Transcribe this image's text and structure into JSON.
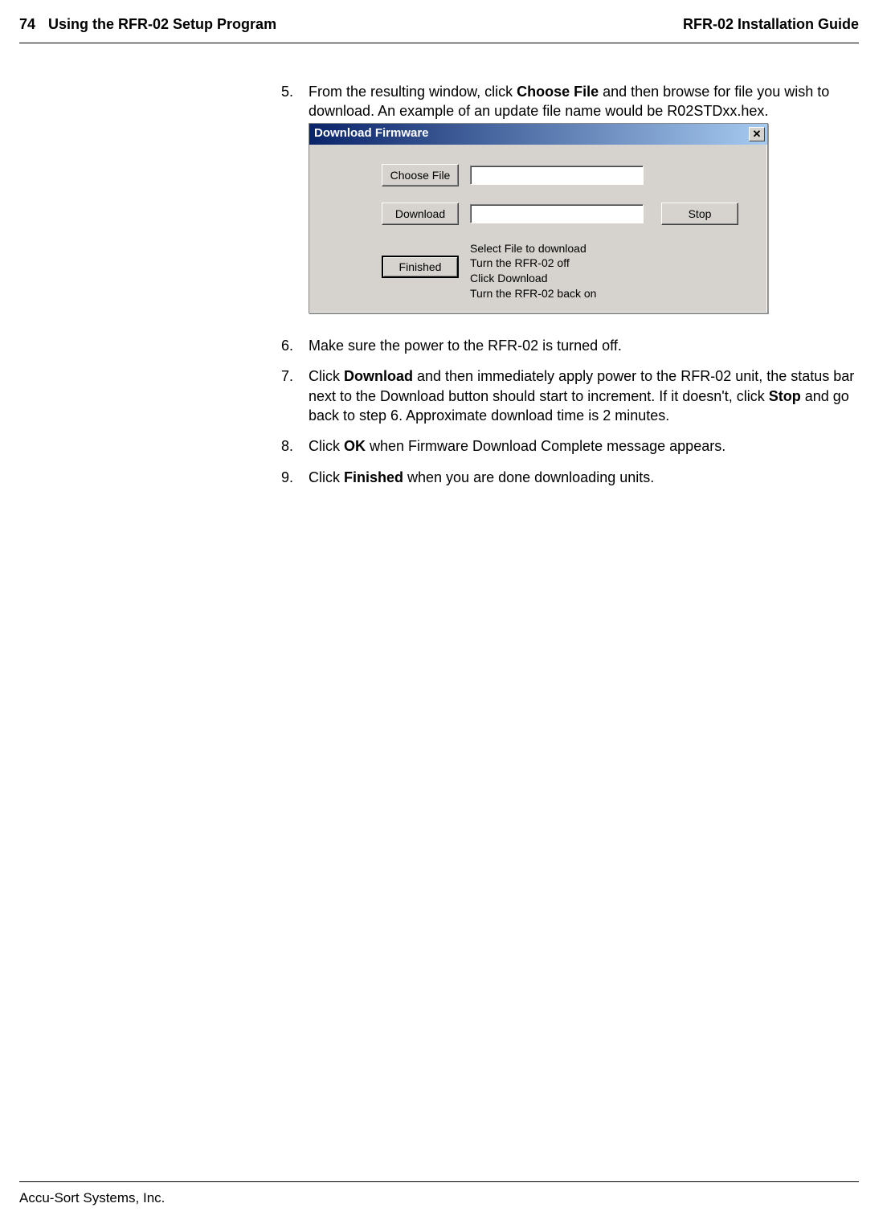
{
  "header": {
    "page_number": "74",
    "section_title": "Using the RFR-02 Setup Program",
    "doc_title": "RFR-02 Installation Guide"
  },
  "steps": [
    {
      "num": "5.",
      "pre": "From the resulting window, click ",
      "bold1": "Choose File",
      "post1": " and then browse for file you wish to download. An example of an update file name would be R02STDxx.hex."
    },
    {
      "num": "6.",
      "pre": "Make sure the power to the RFR-02 is turned off."
    },
    {
      "num": "7.",
      "pre": "Click ",
      "bold1": "Download",
      "post1": " and then immediately apply power to the RFR-02 unit, the status bar next to the Download button should start to increment. If it doesn't, click ",
      "bold2": "Stop",
      "post2": " and go back to step 6. Approximate download time is 2 minutes."
    },
    {
      "num": "8.",
      "pre": "Click ",
      "bold1": "OK",
      "post1": " when Firmware Download Complete message appears."
    },
    {
      "num": "9.",
      "pre": "Click ",
      "bold1": "Finished",
      "post1": " when you are done downloading units."
    }
  ],
  "dialog": {
    "title": "Download Firmware",
    "close": "✕",
    "choose_file": "Choose File",
    "download": "Download",
    "stop": "Stop",
    "finished": "Finished",
    "info": [
      "Select File to download",
      "Turn the RFR-02 off",
      "Click Download",
      "Turn the RFR-02 back on"
    ]
  },
  "footer": "Accu-Sort Systems, Inc."
}
